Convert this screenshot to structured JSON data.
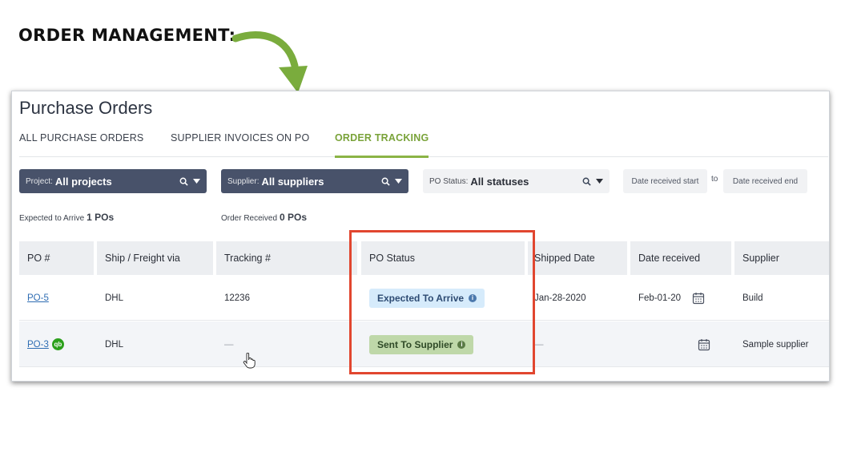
{
  "heading": "ORDER MANAGEMENT:",
  "page_title": "Purchase Orders",
  "tabs": [
    {
      "label": "ALL PURCHASE ORDERS"
    },
    {
      "label": "SUPPLIER INVOICES ON PO"
    },
    {
      "label": "ORDER TRACKING"
    }
  ],
  "filters": {
    "project": {
      "label": "Project:",
      "value": "All projects"
    },
    "supplier": {
      "label": "Supplier:",
      "value": "All suppliers"
    },
    "status": {
      "label": "PO Status:",
      "value": "All statuses"
    },
    "date_start": "Date received start",
    "date_to": "to",
    "date_end": "Date received end"
  },
  "summary": {
    "expected_label": "Expected to Arrive",
    "expected_value": "1 POs",
    "received_label": "Order Received",
    "received_value": "0 POs"
  },
  "columns": [
    "PO #",
    "Ship / Freight via",
    "Tracking #",
    "PO Status",
    "Shipped Date",
    "Date received",
    "Supplier"
  ],
  "rows": [
    {
      "po": "PO-5",
      "ship": "DHL",
      "tracking": "12236",
      "status": "Expected To Arrive",
      "shipped": "Jan-28-2020",
      "received": "Feb-01-20",
      "supplier": "Build"
    },
    {
      "po": "PO-3",
      "qb": "qb",
      "ship": "DHL",
      "tracking": "—",
      "status": "Sent To Supplier",
      "shipped": "—",
      "received": "",
      "supplier": "Sample supplier"
    }
  ],
  "icons": {
    "info": "i",
    "search": "search-icon",
    "dropdown": "caret-down-icon",
    "calendar": "calendar-icon"
  },
  "colors": {
    "accent_green": "#8bb446",
    "filter_dark": "#48526a",
    "highlight_red": "#e1462f",
    "badge_blue": "#d6ebfb",
    "badge_green": "#bfd8a9"
  }
}
